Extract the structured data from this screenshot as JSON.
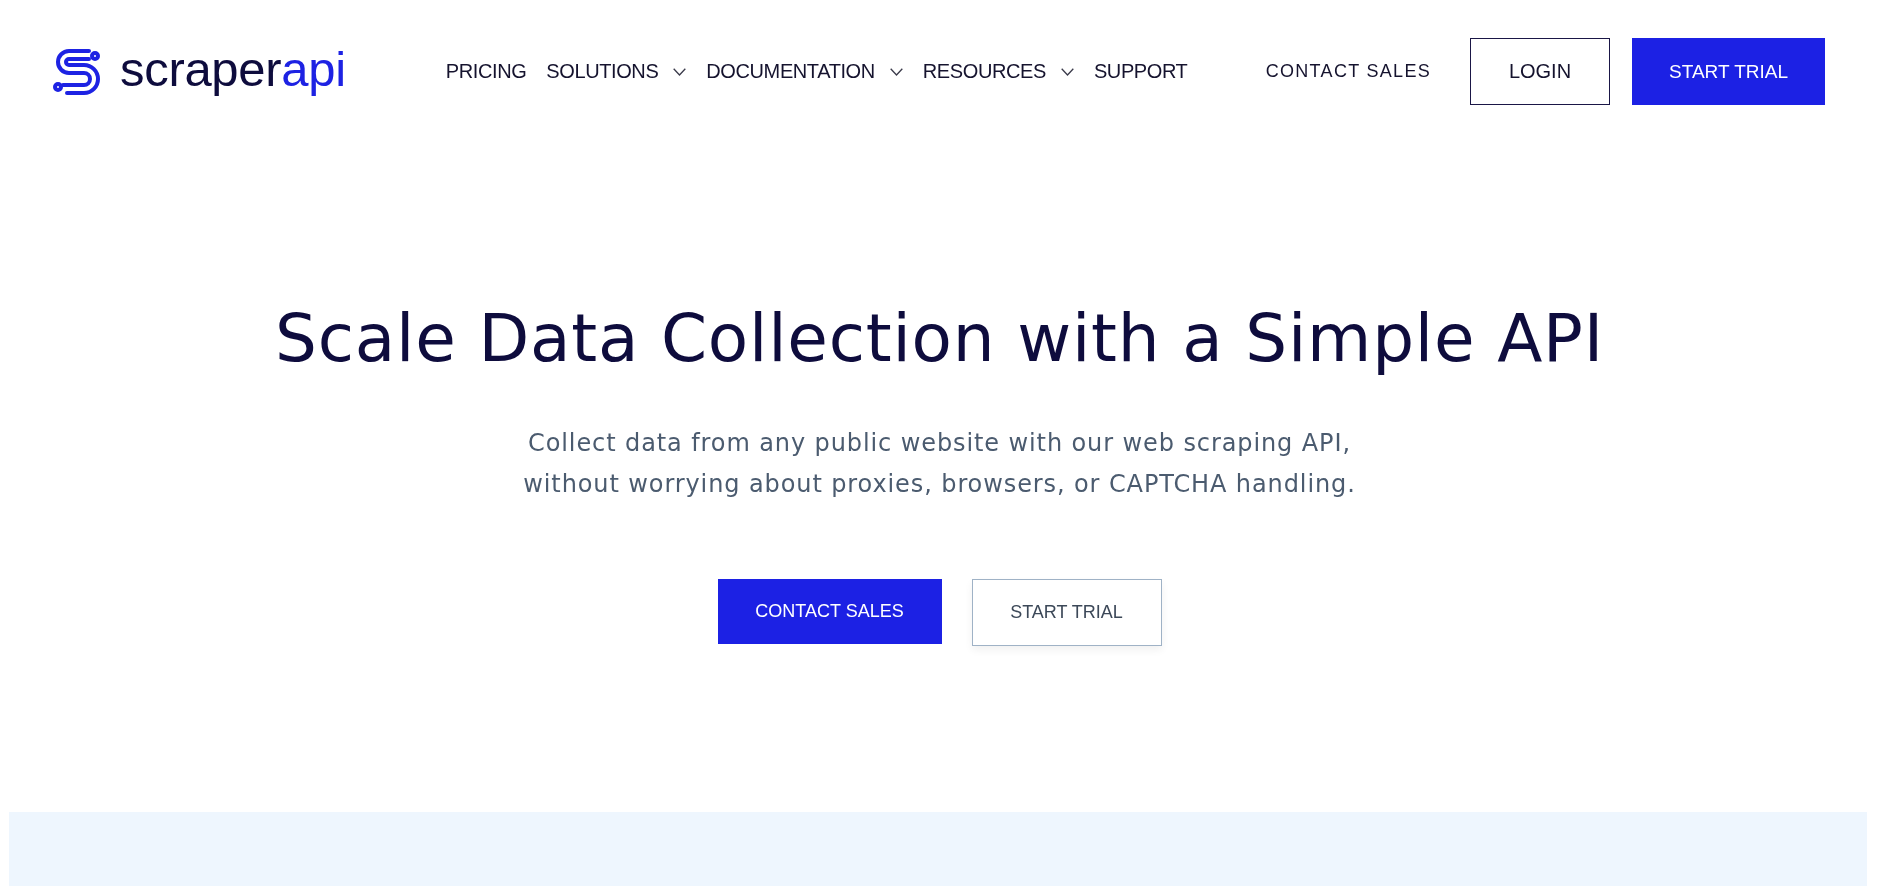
{
  "header": {
    "logo": {
      "name": "scraper",
      "accent": "api"
    },
    "nav": [
      {
        "label": "PRICING",
        "dropdown": false
      },
      {
        "label": "SOLUTIONS",
        "dropdown": true
      },
      {
        "label": "DOCUMENTATION",
        "dropdown": true
      },
      {
        "label": "RESOURCES",
        "dropdown": true
      },
      {
        "label": "SUPPORT",
        "dropdown": false
      }
    ],
    "actions": [
      {
        "label": "CONTACT SALES",
        "kind": "link"
      },
      {
        "label": "LOGIN",
        "kind": "outline"
      },
      {
        "label": "START TRIAL",
        "kind": "primary"
      }
    ]
  },
  "hero": {
    "title": "Scale Data Collection with a Simple API",
    "subtitle": "Collect data from any public website with our web scraping API, without worrying about proxies, browsers, or CAPTCHA handling.",
    "buttons": [
      {
        "label": "CONTACT SALES",
        "kind": "primary"
      },
      {
        "label": "START TRIAL",
        "kind": "secondary"
      }
    ]
  }
}
